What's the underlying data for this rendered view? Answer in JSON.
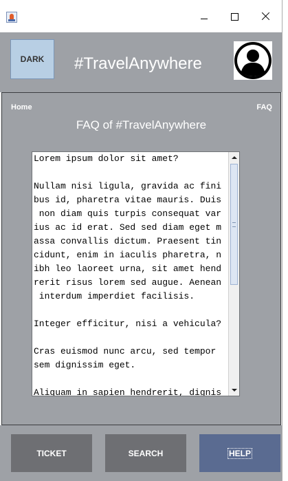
{
  "window": {
    "icon": "java-coffee-icon",
    "controls": [
      "minimize-icon",
      "maximize-icon",
      "close-icon"
    ]
  },
  "header": {
    "dark_label": "DARK",
    "title": "#TravelAnywhere",
    "avatar_icon": "user-avatar-icon"
  },
  "nav": {
    "home": "Home",
    "faq": "FAQ"
  },
  "main": {
    "title": "FAQ of #TravelAnywhere",
    "faq_text": "Lorem ipsum dolor sit amet?\n\nNullam nisi ligula, gravida ac fini\nbus id, pharetra vitae mauris. Duis\n non diam quis turpis consequat var\nius ac id erat. Sed sed diam eget m\nassa convallis dictum. Praesent tin\ncidunt, enim in iaculis pharetra, n\nibh leo laoreet urna, sit amet hend\nrerit risus lorem sed augue. Aenean\n interdum imperdiet facilisis.\n\nInteger efficitur, nisi a vehicula?\n\nCras euismod nunc arcu, sed tempor\nsem dignissim eget.\n\nAliquam in sapien hendrerit, dignis"
  },
  "footer": {
    "ticket": "TICKET",
    "search": "SEARCH",
    "help": "HELP"
  },
  "colors": {
    "panel": "#9ea1a6",
    "button": "#6e6f73",
    "active_button": "#5a6b91",
    "dark_button": "#b8cfe4"
  }
}
